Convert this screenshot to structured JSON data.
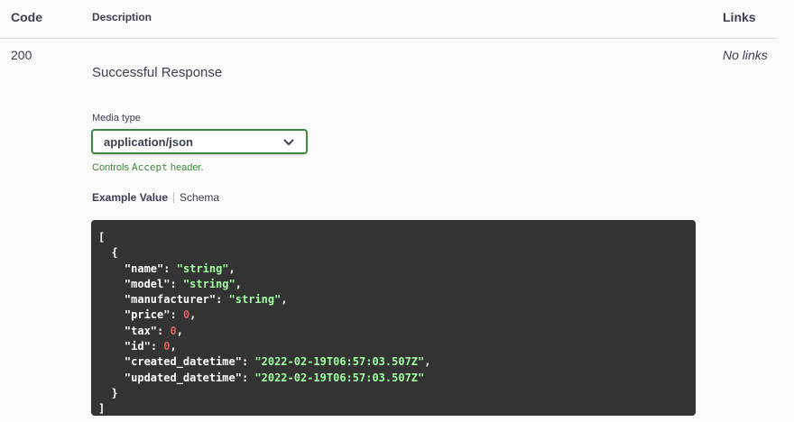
{
  "header": {
    "code": "Code",
    "description": "Description",
    "links": "Links"
  },
  "response": {
    "code": "200",
    "description": "Successful Response",
    "links": "No links"
  },
  "media_type": {
    "label": "Media type",
    "selected": "application/json",
    "controls_prefix": "Controls",
    "controls_mono": "Accept",
    "controls_suffix": "header."
  },
  "tabs": {
    "example_value": "Example Value",
    "schema": "Schema"
  },
  "example": {
    "fields": [
      {
        "key": "name",
        "value": "\"string\"",
        "type": "string"
      },
      {
        "key": "model",
        "value": "\"string\"",
        "type": "string"
      },
      {
        "key": "manufacturer",
        "value": "\"string\"",
        "type": "string"
      },
      {
        "key": "price",
        "value": "0",
        "type": "number"
      },
      {
        "key": "tax",
        "value": "0",
        "type": "number"
      },
      {
        "key": "id",
        "value": "0",
        "type": "number"
      },
      {
        "key": "created_datetime",
        "value": "\"2022-02-19T06:57:03.507Z\"",
        "type": "string"
      },
      {
        "key": "updated_datetime",
        "value": "\"2022-02-19T06:57:03.507Z\"",
        "type": "string"
      }
    ]
  },
  "colors": {
    "accent_green": "#41873f",
    "code_bg": "#333333",
    "code_string": "#a2fca2",
    "code_number": "#d36363"
  }
}
